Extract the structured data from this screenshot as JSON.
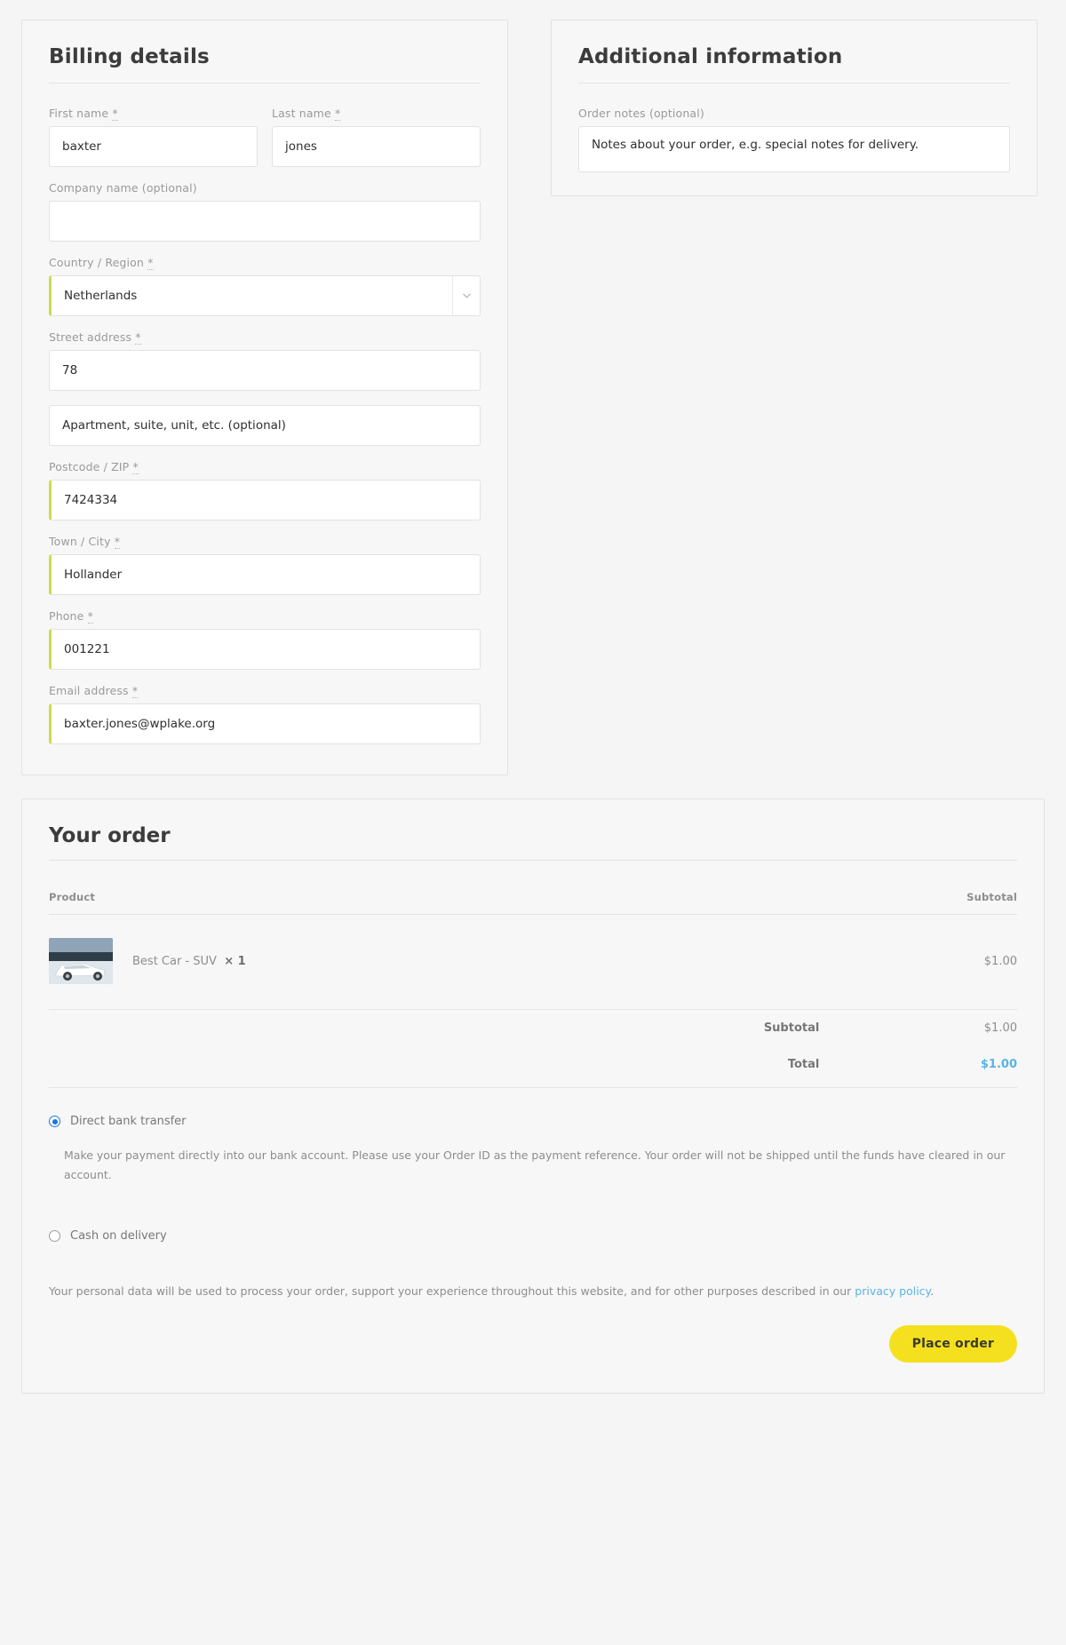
{
  "billing": {
    "title": "Billing details",
    "fields": {
      "first_name": {
        "label": "First name",
        "required_mark": "*",
        "value": "baxter"
      },
      "last_name": {
        "label": "Last name",
        "required_mark": "*",
        "value": "jones"
      },
      "company": {
        "label": "Company name (optional)",
        "value": ""
      },
      "country": {
        "label": "Country / Region",
        "required_mark": "*",
        "value": "Netherlands",
        "arrow_icon": "chevron-down-icon"
      },
      "street": {
        "label": "Street address",
        "required_mark": "*",
        "value": "78"
      },
      "apartment": {
        "placeholder": "Apartment, suite, unit, etc. (optional)",
        "value": "Apartment, suite, unit, etc. (optional)"
      },
      "postcode": {
        "label": "Postcode / ZIP",
        "required_mark": "*",
        "value": "7424334"
      },
      "city": {
        "label": "Town / City",
        "required_mark": "*",
        "value": "Hollander"
      },
      "phone": {
        "label": "Phone",
        "required_mark": "*",
        "value": "001221"
      },
      "email": {
        "label": "Email address",
        "required_mark": "*",
        "value": "baxter.jones@wplake.org"
      }
    }
  },
  "additional": {
    "title": "Additional information",
    "notes_label": "Order notes (optional)",
    "notes_placeholder": "Notes about your order, e.g. special notes for delivery.",
    "notes_value": "Notes about your order, e.g. special notes for delivery."
  },
  "order": {
    "title": "Your order",
    "columns": {
      "product": "Product",
      "subtotal": "Subtotal"
    },
    "items": [
      {
        "name": "Best Car - SUV",
        "qty_label": "× 1",
        "price": "$1.00",
        "thumb_icon": "suv-car-thumbnail"
      }
    ],
    "totals": [
      {
        "label": "Subtotal",
        "value": "$1.00"
      },
      {
        "label": "Total",
        "value": "$1.00"
      }
    ]
  },
  "payment": {
    "methods": [
      {
        "label": "Direct bank transfer",
        "selected": true
      },
      {
        "label": "Cash on delivery",
        "selected": false
      }
    ],
    "bank_transfer_description": "Make your payment directly into our bank account. Please use your Order ID as the payment reference. Your order will not be shipped until the funds have cleared in our account.",
    "privacy_text_before": "Your personal data will be used to process your order, support your experience throughout this website, and for other purposes described in our ",
    "privacy_link": "privacy policy",
    "privacy_text_after": ".",
    "place_order_label": "Place order"
  },
  "colors": {
    "accent_total": "#58b4e5",
    "valid_border": "#cddc4b",
    "button": "#f5e020",
    "radio_selected": "#1a73e8"
  }
}
